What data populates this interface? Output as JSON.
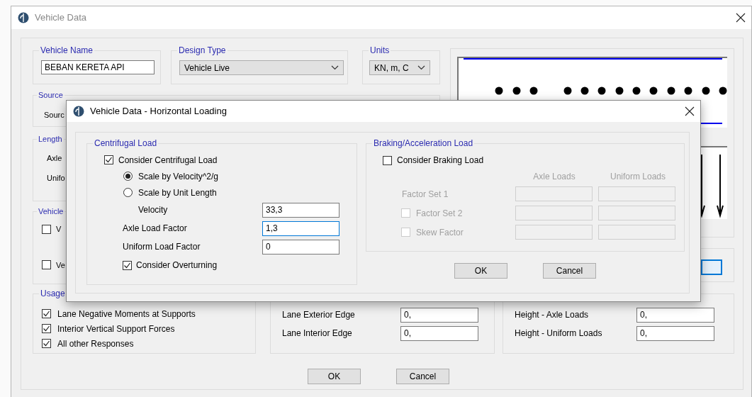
{
  "window": {
    "title": "Vehicle Data"
  },
  "vehicle_name": {
    "label": "Vehicle Name",
    "value": "BEBAN KERETA API"
  },
  "design_type": {
    "label": "Design Type",
    "value": "Vehicle Live"
  },
  "units": {
    "label": "Units",
    "value": "KN, m, C"
  },
  "source": {
    "label": "Source",
    "field_label": "Sourc"
  },
  "length": {
    "label": "Length",
    "rows": [
      "Axle",
      "Unifo"
    ]
  },
  "vehicle_options": {
    "label": "Vehicle",
    "items": [
      {
        "label": "V",
        "checked": false
      },
      {
        "label": "Ve",
        "checked": false
      }
    ]
  },
  "usage": {
    "label": "Usage",
    "items": [
      {
        "label": "Lane Negative Moments at Supports",
        "checked": true
      },
      {
        "label": "Interior Vertical Support Forces",
        "checked": true
      },
      {
        "label": "All other Responses",
        "checked": true
      }
    ]
  },
  "min_distance": {
    "rows": [
      {
        "label": "Lane Exterior Edge",
        "value": "0,"
      },
      {
        "label": "Lane Interior Edge",
        "value": "0,"
      }
    ]
  },
  "center_of_gravity": {
    "rows": [
      {
        "label": "Height - Axle Loads",
        "value": "0,"
      },
      {
        "label": "Height - Uniform Loads",
        "value": "0,"
      }
    ]
  },
  "buttons": [
    "OK",
    "Cancel"
  ],
  "dialog": {
    "title": "Vehicle Data - Horizontal Loading",
    "centrifugal": {
      "label": "Centrifugal Load",
      "consider": {
        "label": "Consider Centrifugal Load",
        "checked": true
      },
      "scale_options": [
        {
          "label": "Scale by Velocity^2/g",
          "selected": true
        },
        {
          "label": "Scale by Unit Length",
          "selected": false
        }
      ],
      "fields": [
        {
          "label": "Velocity",
          "value": "33,3",
          "focused": false,
          "indent": true
        },
        {
          "label": "Axle Load Factor",
          "value": "1,3",
          "focused": true,
          "indent": false
        },
        {
          "label": "Uniform Load Factor",
          "value": "0",
          "focused": false,
          "indent": false
        }
      ],
      "overturning": {
        "label": "Consider Overturning",
        "checked": true
      }
    },
    "braking": {
      "label": "Braking/Acceleration Load",
      "disabled": true,
      "consider": {
        "label": "Consider Braking Load",
        "checked": false
      },
      "columns": [
        "Axle Loads",
        "Uniform Loads"
      ],
      "rows": [
        {
          "kind": "label",
          "label": "Factor Set 1"
        },
        {
          "kind": "checkbox",
          "label": "Factor Set 2",
          "checked": false
        },
        {
          "kind": "checkbox",
          "label": "Skew Factor",
          "checked": false
        }
      ]
    },
    "buttons": [
      "OK",
      "Cancel"
    ]
  }
}
